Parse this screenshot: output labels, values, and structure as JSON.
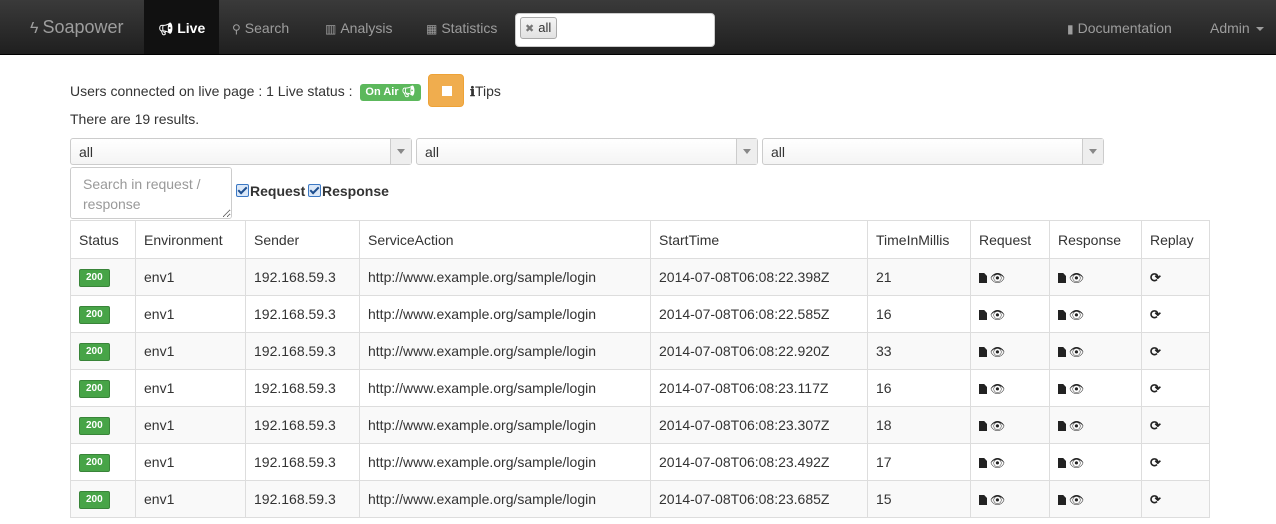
{
  "navbar": {
    "brand": "Soapower",
    "items": [
      {
        "label": "Live",
        "icon": "megaphone-icon",
        "active": true
      },
      {
        "label": "Search",
        "icon": "search-icon"
      },
      {
        "label": "Analysis",
        "icon": "bar-chart-icon"
      },
      {
        "label": "Statistics",
        "icon": "table-icon"
      }
    ],
    "tag_filter": "all",
    "documentation": "Documentation",
    "admin": "Admin"
  },
  "status": {
    "users_text": "Users connected on live page : 1 Live status :",
    "on_air": "On Air",
    "tips": "Tips",
    "results_text": "There are 19 results."
  },
  "filters": {
    "select1": "all",
    "select2": "all",
    "select3": "all",
    "search_placeholder": "Search in request / response",
    "request_label": "Request",
    "response_label": "Response"
  },
  "table": {
    "headers": [
      "Status",
      "Environment",
      "Sender",
      "ServiceAction",
      "StartTime",
      "TimeInMillis",
      "Request",
      "Response",
      "Replay"
    ],
    "rows": [
      {
        "status": "200",
        "env": "env1",
        "sender": "192.168.59.3",
        "action": "http://www.example.org/sample/login",
        "start": "2014-07-08T06:08:22.398Z",
        "time": "21"
      },
      {
        "status": "200",
        "env": "env1",
        "sender": "192.168.59.3",
        "action": "http://www.example.org/sample/login",
        "start": "2014-07-08T06:08:22.585Z",
        "time": "16"
      },
      {
        "status": "200",
        "env": "env1",
        "sender": "192.168.59.3",
        "action": "http://www.example.org/sample/login",
        "start": "2014-07-08T06:08:22.920Z",
        "time": "33"
      },
      {
        "status": "200",
        "env": "env1",
        "sender": "192.168.59.3",
        "action": "http://www.example.org/sample/login",
        "start": "2014-07-08T06:08:23.117Z",
        "time": "16"
      },
      {
        "status": "200",
        "env": "env1",
        "sender": "192.168.59.3",
        "action": "http://www.example.org/sample/login",
        "start": "2014-07-08T06:08:23.307Z",
        "time": "18"
      },
      {
        "status": "200",
        "env": "env1",
        "sender": "192.168.59.3",
        "action": "http://www.example.org/sample/login",
        "start": "2014-07-08T06:08:23.492Z",
        "time": "17"
      },
      {
        "status": "200",
        "env": "env1",
        "sender": "192.168.59.3",
        "action": "http://www.example.org/sample/login",
        "start": "2014-07-08T06:08:23.685Z",
        "time": "15"
      }
    ]
  }
}
